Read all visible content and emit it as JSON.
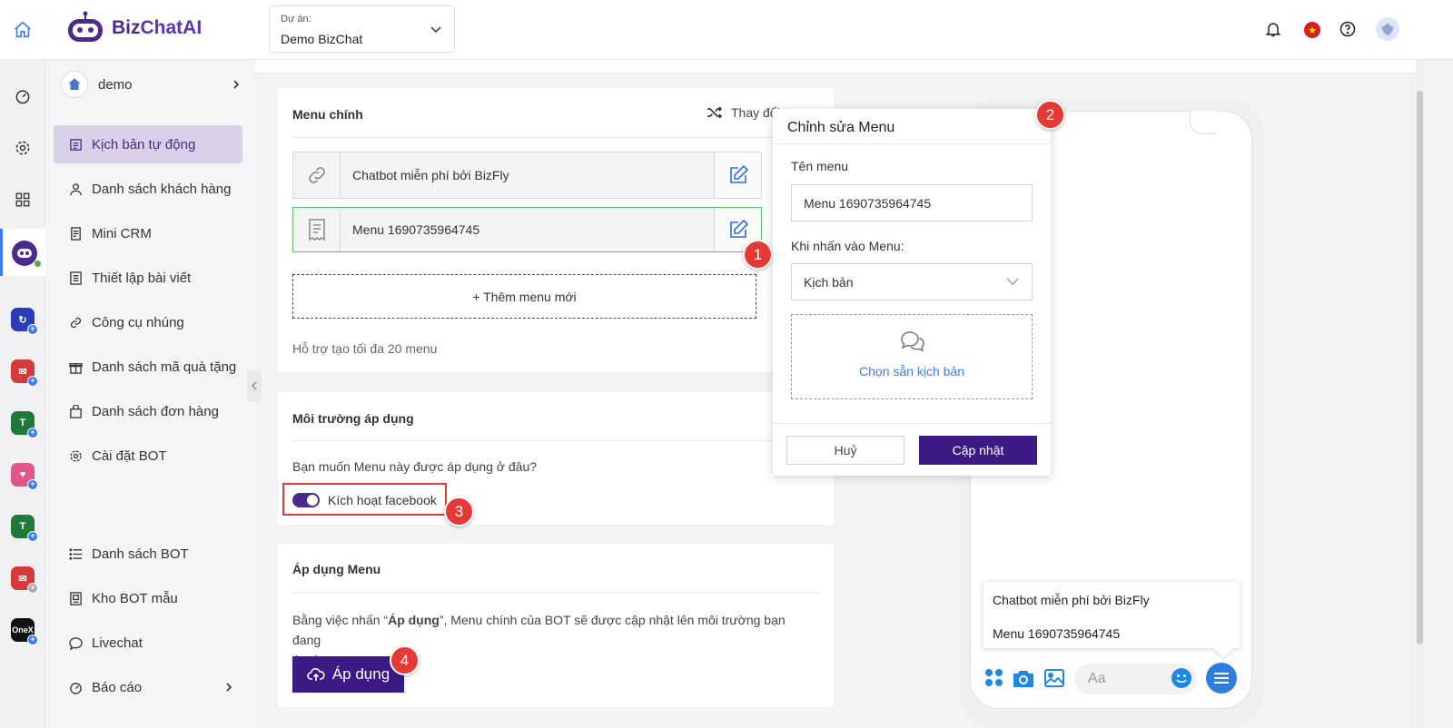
{
  "brand": {
    "name_part1": "Biz",
    "name_part2": "ChatAI"
  },
  "project": {
    "label": "Dự án:",
    "value": "Demo BizChat"
  },
  "colors": {
    "primary": "#3b1a85",
    "accent_active_bg": "#d9d0e8",
    "badge": "#e53935",
    "toggle": "#4a2a8c",
    "green_border": "#5cbf6b"
  },
  "sidebar": {
    "account": "demo",
    "items": [
      {
        "label": "Kịch bản tự động",
        "icon": "script-icon"
      },
      {
        "label": "Danh sách khách hàng",
        "icon": "user-icon"
      },
      {
        "label": "Mini CRM",
        "icon": "crm-icon"
      },
      {
        "label": "Thiết lập bài viết",
        "icon": "post-icon"
      },
      {
        "label": "Công cụ nhúng",
        "icon": "link-icon"
      },
      {
        "label": "Danh sách mã quà tặng",
        "icon": "gift-icon"
      },
      {
        "label": "Danh sách đơn hàng",
        "icon": "bag-icon"
      },
      {
        "label": "Cài đặt BOT",
        "icon": "gear-icon"
      },
      {
        "label": "Danh sách BOT",
        "icon": "list-icon"
      },
      {
        "label": "Kho BOT mẫu",
        "icon": "template-icon"
      },
      {
        "label": "Livechat",
        "icon": "chat-icon"
      },
      {
        "label": "Báo cáo",
        "icon": "report-icon"
      }
    ]
  },
  "rail": {
    "onex_label": "OneX"
  },
  "main_menu": {
    "title": "Menu chính",
    "change_label": "Thay đổi",
    "items": [
      "Chatbot miễn phí bởi BizFly",
      "Menu 1690735964745"
    ],
    "add_label": "+ Thêm menu mới",
    "hint": "Hỗ trợ tạo tối đa 20 menu"
  },
  "environment": {
    "title": "Môi trường áp dụng",
    "question": "Bạn muốn Menu này được áp dụng ở đâu?",
    "toggle_label": "Kích hoạt facebook",
    "toggle_on": true
  },
  "apply": {
    "title": "Áp dụng Menu",
    "desc_before": "Bằng việc nhấn “",
    "desc_bold": "Áp dụng",
    "desc_after": "”, Menu chính của BOT sẽ được cập nhật lên môi trường bạn đang",
    "desc_line2": "áp dụng.",
    "button": "Áp dụng"
  },
  "edit_modal": {
    "title": "Chỉnh sửa Menu",
    "name_label": "Tên menu",
    "name_value": "Menu 1690735964745",
    "action_label": "Khi nhấn vào Menu:",
    "action_value": "Kịch bản",
    "choose_label": "Chọn sẵn kịch bản",
    "cancel": "Huỷ",
    "update": "Cập nhật"
  },
  "phone": {
    "menu_items": [
      "Chatbot miễn phí bởi BizFly",
      "Menu 1690735964745"
    ],
    "input_placeholder": "Aa"
  },
  "badges": [
    "1",
    "2",
    "3",
    "4"
  ]
}
